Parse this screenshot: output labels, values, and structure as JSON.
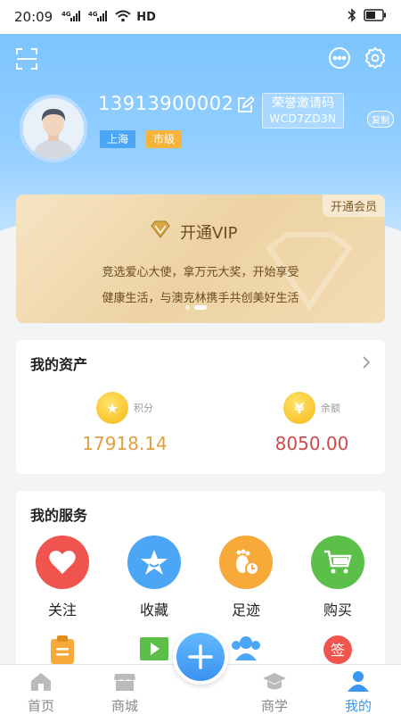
{
  "status_bar": {
    "time": "20:09",
    "net1": "4G",
    "net2": "4G",
    "hd": "HD"
  },
  "profile": {
    "phone": "13913900002",
    "invite_title": "荣誉邀请码",
    "invite_code": "WCD7ZD3N",
    "copy_label": "复制",
    "city_tag": "上海",
    "level_tag": "市级"
  },
  "vip": {
    "corner_label": "开通会员",
    "title": "开通VIP",
    "desc_line1": "竞选爱心大使，拿万元大奖，开始享受",
    "desc_line2": "健康生活，与澳克林携手共创美好生活"
  },
  "assets": {
    "title": "我的资产",
    "points_label": "积分",
    "points_value": "17918.14",
    "balance_label": "余额",
    "balance_value": "8050.00"
  },
  "services": {
    "title": "我的服务",
    "items": [
      {
        "label": "关注",
        "icon": "heart-icon",
        "color": "#f0544f"
      },
      {
        "label": "收藏",
        "icon": "star-icon",
        "color": "#4ba6f6"
      },
      {
        "label": "足迹",
        "icon": "footprint-icon",
        "color": "#f7a93a"
      },
      {
        "label": "购买",
        "icon": "cart-icon",
        "color": "#5bbf4a"
      }
    ],
    "partial_icons": [
      "clipboard-icon",
      "video-icon",
      "people-icon",
      "sign-in-icon"
    ]
  },
  "tabbar": {
    "items": [
      {
        "label": "首页",
        "icon": "home-icon"
      },
      {
        "label": "商城",
        "icon": "shop-icon"
      },
      {
        "label": "商学",
        "icon": "graduation-cap-icon"
      },
      {
        "label": "我的",
        "icon": "user-icon"
      }
    ],
    "active_index": 3,
    "accent": "#3a96ef"
  }
}
